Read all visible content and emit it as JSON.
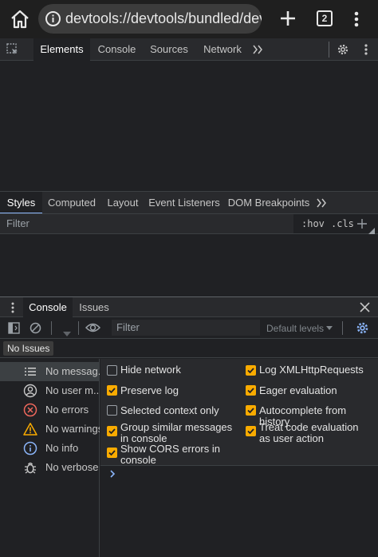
{
  "browser": {
    "url": "devtools://devtools/bundled/devtc",
    "tab_count": "2"
  },
  "main_tabs": [
    "Elements",
    "Console",
    "Sources",
    "Network"
  ],
  "styles_tabs": [
    "Styles",
    "Computed",
    "Layout",
    "Event Listeners",
    "DOM Breakpoints"
  ],
  "styles_filter": {
    "placeholder": "Filter",
    "hov": ":hov",
    "cls": ".cls"
  },
  "drawer_tabs": [
    "Console",
    "Issues"
  ],
  "console_toolbar": {
    "filter_placeholder": "Filter",
    "levels": "Default levels"
  },
  "issues_badge": "No Issues",
  "sidebar": [
    {
      "label": "No messag...",
      "icon": "list-icon"
    },
    {
      "label": "No user m...",
      "icon": "user-icon"
    },
    {
      "label": "No errors",
      "icon": "error-icon"
    },
    {
      "label": "No warnings",
      "icon": "warning-icon"
    },
    {
      "label": "No info",
      "icon": "info-icon"
    },
    {
      "label": "No verbose",
      "icon": "bug-icon"
    }
  ],
  "settings": {
    "left": [
      {
        "label": "Hide network",
        "checked": false
      },
      {
        "label": "Preserve log",
        "checked": true
      },
      {
        "label": "Selected context only",
        "checked": false
      },
      {
        "label": "Group similar messages in console",
        "checked": true
      },
      {
        "label": "Show CORS errors in console",
        "checked": true
      }
    ],
    "right": [
      {
        "label": "Log XMLHttpRequests",
        "checked": true
      },
      {
        "label": "Eager evaluation",
        "checked": true
      },
      {
        "label": "Autocomplete from history",
        "checked": true
      },
      {
        "label": "Treat code evaluation as user action",
        "checked": true
      }
    ]
  },
  "colors": {
    "accent": "#f9ab00",
    "link_blue": "#8ab4f8",
    "error": "#ee675c",
    "warning": "#f9ab00"
  }
}
